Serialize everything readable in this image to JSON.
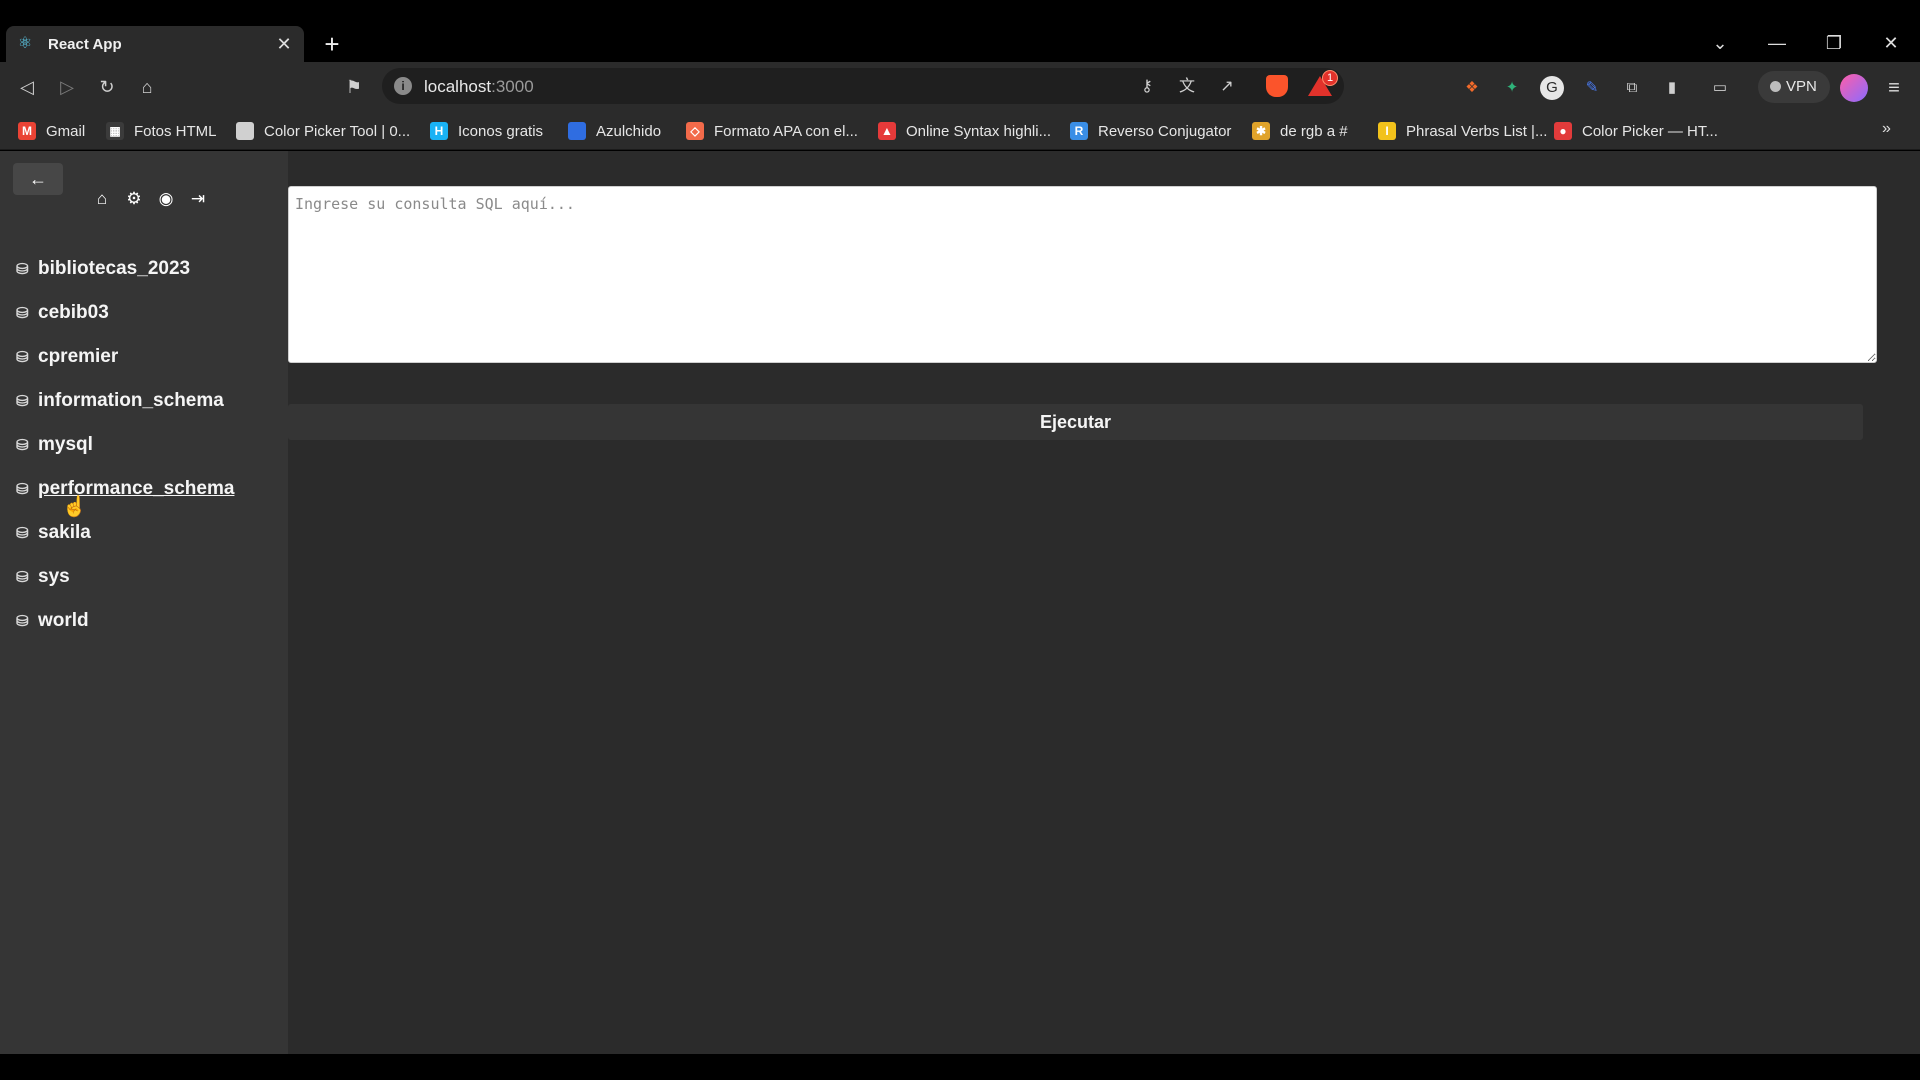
{
  "tab": {
    "title": "React App"
  },
  "window": {
    "close_glyph": "✕",
    "newtab_glyph": "+"
  },
  "address": {
    "host": "localhost",
    "port": ":3000"
  },
  "toolbar": {
    "rewards_count": "1",
    "vpn_label": "VPN"
  },
  "bookmarks": [
    {
      "label": "Gmail",
      "color": "#ea4335",
      "glyph": "M"
    },
    {
      "label": "Fotos HTML",
      "color": "#3b3b3b",
      "glyph": "▦"
    },
    {
      "label": "Color Picker Tool | 0...",
      "color": "#d0d0d0",
      "glyph": ""
    },
    {
      "label": "Iconos gratis",
      "color": "#19b2f5",
      "glyph": "H"
    },
    {
      "label": "Azulchido",
      "color": "#2f6de1",
      "glyph": ""
    },
    {
      "label": "Formato APA con el...",
      "color": "#f26a4a",
      "glyph": "◇"
    },
    {
      "label": "Online Syntax highli...",
      "color": "#e53a3a",
      "glyph": "▲"
    },
    {
      "label": "Reverso Conjugator",
      "color": "#3a8ee6",
      "glyph": "R"
    },
    {
      "label": "de rgb a #",
      "color": "#e0a32a",
      "glyph": "✱"
    },
    {
      "label": "Phrasal Verbs List |...",
      "color": "#f2c21b",
      "glyph": "I"
    },
    {
      "label": "Color Picker — HT...",
      "color": "#e23b3b",
      "glyph": "●"
    }
  ],
  "sidebar": {
    "back_glyph": "←",
    "databases": [
      {
        "name": "bibliotecas_2023"
      },
      {
        "name": "cebib03"
      },
      {
        "name": "cpremier"
      },
      {
        "name": "information_schema"
      },
      {
        "name": "mysql"
      },
      {
        "name": "performance_schema"
      },
      {
        "name": "sakila"
      },
      {
        "name": "sys"
      },
      {
        "name": "world"
      }
    ]
  },
  "main": {
    "sql_placeholder": "Ingrese su consulta SQL aquí...",
    "run_label": "Ejecutar"
  }
}
